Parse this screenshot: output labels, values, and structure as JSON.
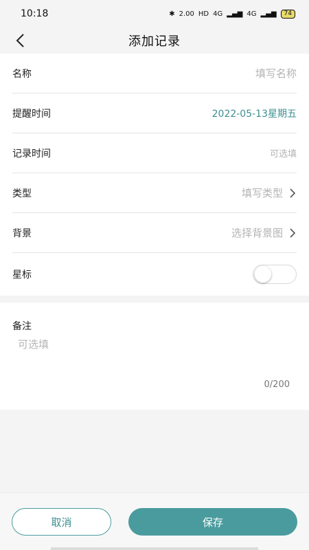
{
  "status_bar": {
    "time": "10:18",
    "speed": "2.00",
    "hd": "HD",
    "net1": "4G",
    "net2": "4G",
    "battery": "74"
  },
  "nav": {
    "title": "添加记录"
  },
  "form": {
    "name": {
      "label": "名称",
      "placeholder": "填写名称"
    },
    "remind_time": {
      "label": "提醒时间",
      "value": "2022-05-13星期五"
    },
    "record_time": {
      "label": "记录时间",
      "placeholder": "可选填"
    },
    "type": {
      "label": "类型",
      "placeholder": "填写类型"
    },
    "background": {
      "label": "背景",
      "placeholder": "选择背景图"
    },
    "star": {
      "label": "星标",
      "enabled": false
    }
  },
  "remark": {
    "label": "备注",
    "placeholder": "可选填",
    "count": "0/200"
  },
  "actions": {
    "cancel_label": "取消",
    "save_label": "保存"
  },
  "colors": {
    "accent": "#4a9b9e",
    "page_bg": "#f4f4f4",
    "placeholder": "#b3b3b3"
  }
}
